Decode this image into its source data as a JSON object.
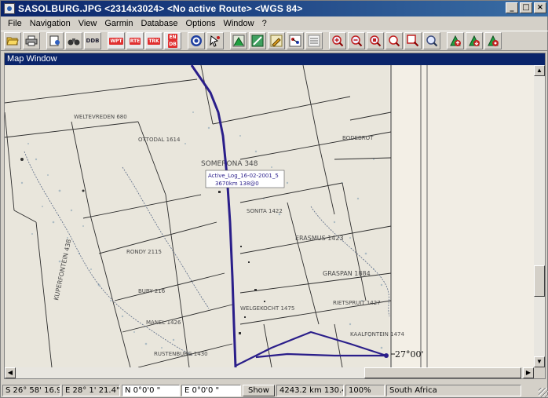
{
  "window": {
    "title": "SASOLBURG.JPG <2314x3024> <No active Route> <WGS 84>",
    "minimize_label": "_",
    "maximize_label": "□",
    "close_label": "×"
  },
  "menu": [
    "File",
    "Navigation",
    "View",
    "Garmin",
    "Database",
    "Options",
    "Window",
    "?"
  ],
  "toolbar": {
    "wpt_label": "WPT",
    "rte_label": "RTE",
    "trk_label": "TRK",
    "en_label": "EN",
    "db_label": "DB",
    "ddb_label": "DDB"
  },
  "map_window": {
    "title": "Map Window",
    "farm_labels": {
      "weltevreden": "WELTEVREDEN 680",
      "ottodal": "OTTODAL 1614",
      "somerona": "SOMERONA 348",
      "bodebrot": "BODEBROT",
      "sonita": "SONITA 1422",
      "erasmus": "ERASMUS 1423",
      "graspan": "GRASPAN 1884",
      "kuperfontein": "KUPERFONTEIN 438",
      "rondy": "RONDY 2115",
      "buby": "BUBY 216",
      "manel": "MANEL 1426",
      "welgekocht": "WELGEKOCHT 1475",
      "rustenburg": "RUSTENBURG 1430",
      "rietspruit": "RIETSPRUIT 1427",
      "kaalfontein": "KAALFONTEIN 1474"
    },
    "track_label_line1": "Active_Log_16-02-2001_5",
    "track_label_line2": "3670km 138@0",
    "latitude_mark": "27°00'"
  },
  "status": {
    "latitude": "S 26° 58' 16.9\"",
    "longitude": "E 28° 1' 21.4\"",
    "north_input": "N 0°0'0 \"",
    "east_input": "E 0°0'0 \"",
    "show_button": "Show",
    "distance": "4243.2 km 130.4 °",
    "zoom": "100%",
    "region": "South Africa"
  },
  "colors": {
    "track": "#2a1e8a",
    "title_bar": "#0a246a",
    "map_paper": "#f1ede4"
  }
}
